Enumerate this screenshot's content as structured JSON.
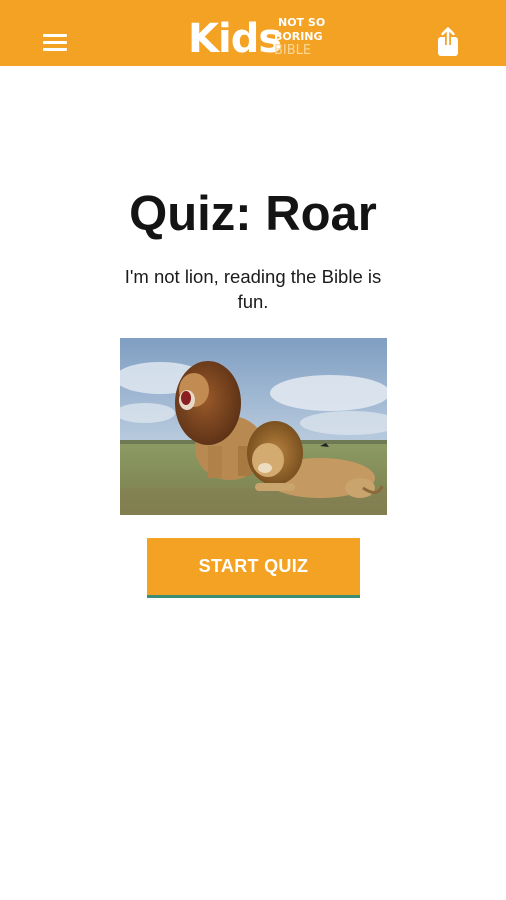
{
  "header": {
    "logo_main": "Kids",
    "logo_tag_line1": "NOT SO",
    "logo_tag_line2": "BORING",
    "logo_tag_line3": "BIBLE",
    "accent_color": "#f4a223",
    "menu_icon": "hamburger-menu-icon",
    "share_icon": "share-icon"
  },
  "quiz": {
    "title": "Quiz: Roar",
    "subtitle": "I'm not lion, reading the Bible is fun.",
    "image_description_icon": "lions-photo",
    "start_label": "START QUIZ",
    "button_color": "#f4a223",
    "button_underline_color": "#3b8e73"
  }
}
